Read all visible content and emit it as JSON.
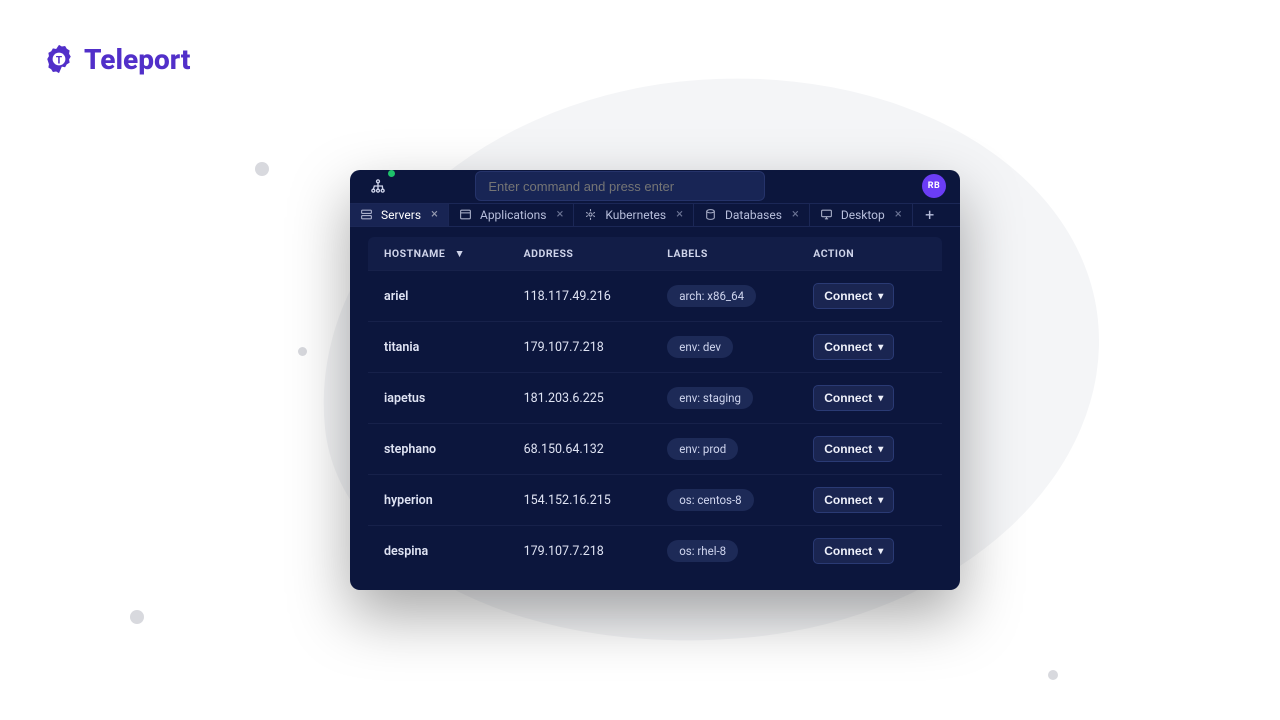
{
  "brand": {
    "name": "Teleport"
  },
  "command_bar": {
    "placeholder": "Enter command and press enter"
  },
  "user": {
    "initials": "RB"
  },
  "tabs": [
    {
      "label": "Servers",
      "icon": "server-icon",
      "active": true
    },
    {
      "label": "Applications",
      "icon": "window-icon",
      "active": false
    },
    {
      "label": "Kubernetes",
      "icon": "k8s-icon",
      "active": false
    },
    {
      "label": "Databases",
      "icon": "database-icon",
      "active": false
    },
    {
      "label": "Desktop",
      "icon": "desktop-icon",
      "active": false
    }
  ],
  "table": {
    "columns": {
      "hostname": "HOSTNAME",
      "address": "ADDRESS",
      "labels": "LABELS",
      "action": "ACTION"
    },
    "action_label": "Connect",
    "rows": [
      {
        "hostname": "ariel",
        "address": "118.117.49.216",
        "label": "arch: x86_64"
      },
      {
        "hostname": "titania",
        "address": "179.107.7.218",
        "label": "env: dev"
      },
      {
        "hostname": "iapetus",
        "address": "181.203.6.225",
        "label": "env: staging"
      },
      {
        "hostname": "stephano",
        "address": "68.150.64.132",
        "label": "env: prod"
      },
      {
        "hostname": "hyperion",
        "address": "154.152.16.215",
        "label": "os: centos-8"
      },
      {
        "hostname": "despina",
        "address": "179.107.7.218",
        "label": "os: rhel-8"
      }
    ]
  }
}
